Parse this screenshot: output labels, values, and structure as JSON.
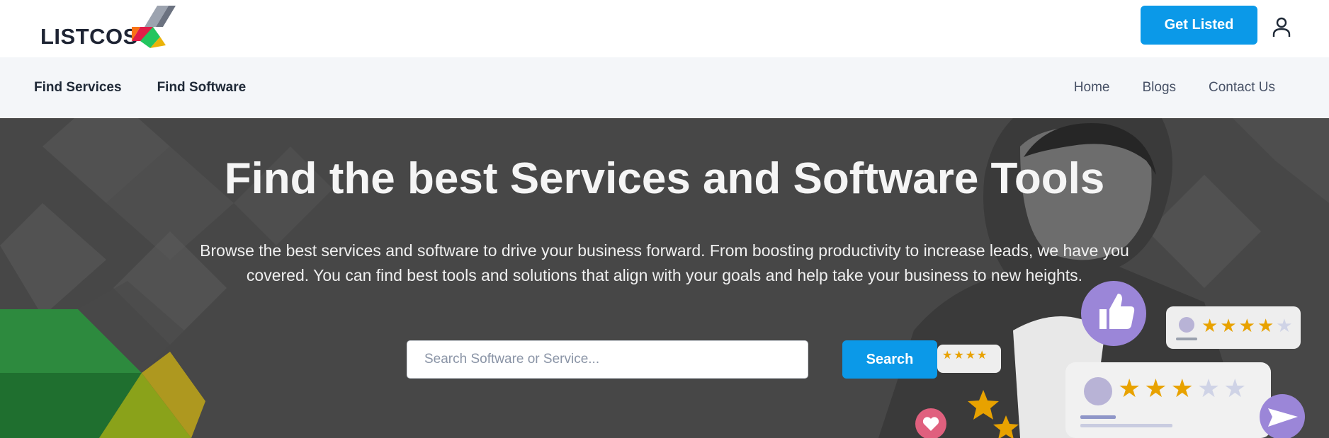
{
  "header": {
    "logo_text": "LISTCOS",
    "cta_label": "Get Listed",
    "user_icon": "user-icon"
  },
  "nav": {
    "left": [
      "Find Services",
      "Find Software"
    ],
    "right": [
      "Home",
      "Blogs",
      "Contact Us"
    ]
  },
  "hero": {
    "title": "Find the best Services and Software Tools",
    "subtitle": "Browse the best services and software to drive your business forward. From boosting productivity to increase leads, we have you covered. You can find best tools and solutions that align with your goals and help take your business to new heights.",
    "search_placeholder": "Search Software or Service...",
    "search_value": "",
    "search_button": "Search",
    "ratings": [
      4,
      3
    ]
  },
  "colors": {
    "accent": "#0b99e8",
    "nav_bg": "#f4f6f9",
    "hero_overlay": "#4a4a4a",
    "star": "#e8a200",
    "badge_purple": "#9b86d8"
  }
}
